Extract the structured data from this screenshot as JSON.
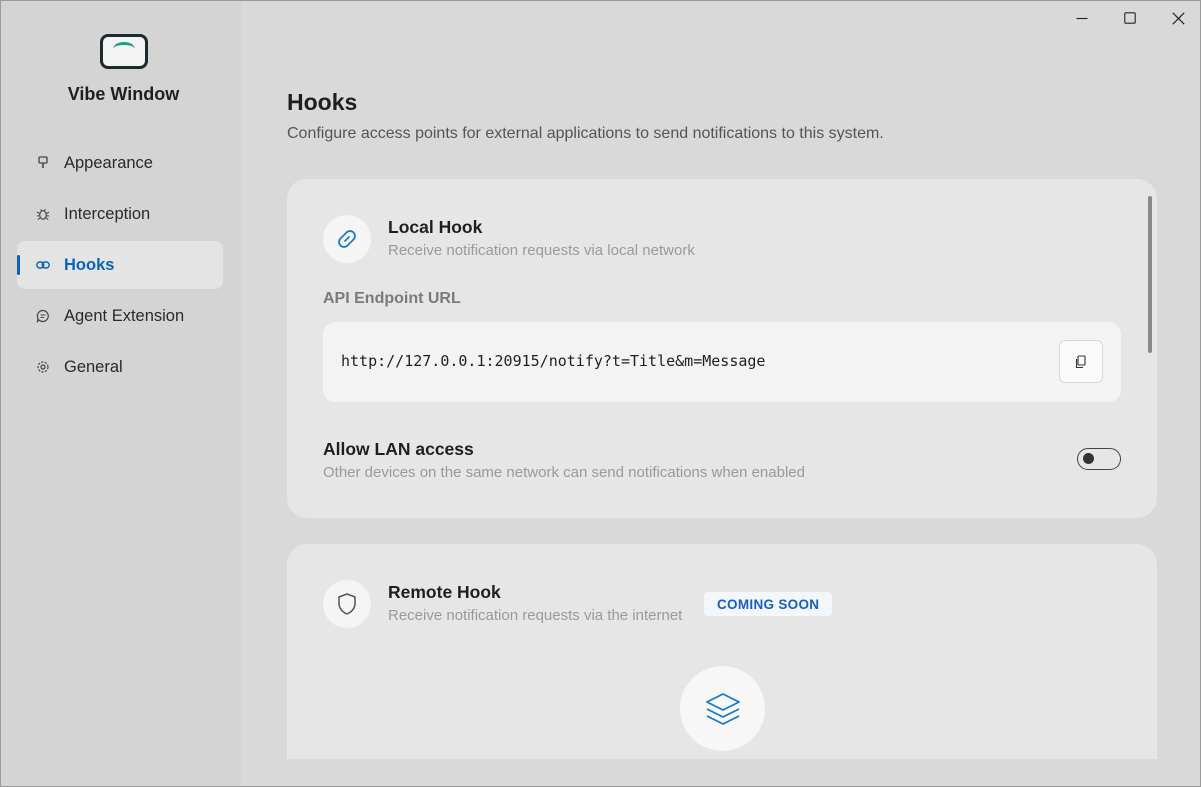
{
  "app": {
    "name": "Vibe Window"
  },
  "sidebar": {
    "items": [
      {
        "label": "Appearance",
        "icon": "brush-icon",
        "active": false
      },
      {
        "label": "Interception",
        "icon": "bug-icon",
        "active": false
      },
      {
        "label": "Hooks",
        "icon": "link-icon",
        "active": true
      },
      {
        "label": "Agent Extension",
        "icon": "chat-bubble-icon",
        "active": false
      },
      {
        "label": "General",
        "icon": "gear-icon",
        "active": false
      }
    ]
  },
  "page": {
    "title": "Hooks",
    "description": "Configure access points for external applications to send notifications to this system."
  },
  "local_hook": {
    "title": "Local Hook",
    "subtitle": "Receive notification requests via local network",
    "endpoint_label": "API Endpoint URL",
    "endpoint_url": "http://127.0.0.1:20915/notify?t=Title&m=Message",
    "lan_title": "Allow LAN access",
    "lan_subtitle": "Other devices on the same network can send notifications when enabled",
    "lan_enabled": false
  },
  "remote_hook": {
    "title": "Remote Hook",
    "subtitle": "Receive notification requests via the internet",
    "badge": "COMING SOON"
  },
  "colors": {
    "accent": "#0a64b4",
    "logo_arc": "#1aa187",
    "link_icon": "#1a7bc4"
  }
}
